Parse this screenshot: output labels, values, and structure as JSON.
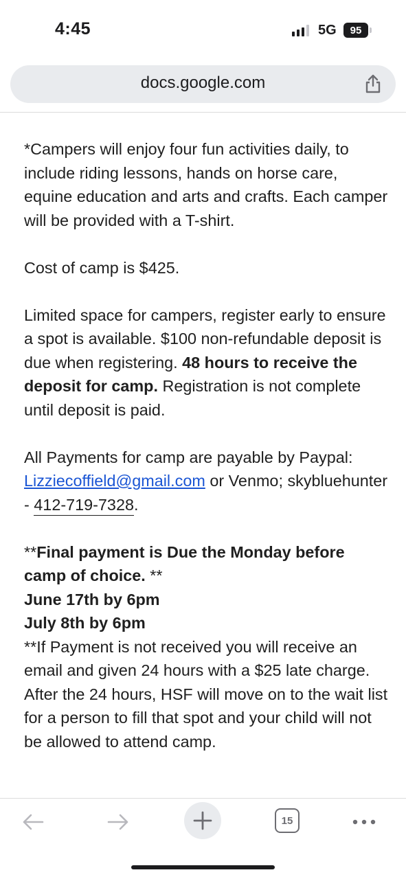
{
  "status_bar": {
    "time": "4:45",
    "network": "5G",
    "battery": "95"
  },
  "browser": {
    "url": "docs.google.com",
    "tab_count": "15"
  },
  "document": {
    "activities": "*Campers will enjoy four fun activities daily, to include riding lessons, hands on horse care, equine education and arts and crafts. Each camper will be provided with a T-shirt.",
    "cost": "Cost of camp is $425.",
    "space_intro": "Limited space for campers, register early to ensure a spot is available. $100 non-refundable deposit is due when registering.",
    "space_bold": "48 hours to receive the deposit for camp.",
    "space_tail": "Registration is not complete until deposit is paid.",
    "payments_intro": "All Payments for camp are payable  by Paypal:",
    "payments_email": "Lizziecoffield@gmail.com",
    "payments_mid": "or Venmo; skybluehunter -",
    "payments_phone": "412-719-7328",
    "payments_end": ".",
    "final_payment_prefix": "**",
    "final_payment_bold": "Final payment is Due the Monday before camp of choice.",
    "final_payment_suffix": " **",
    "date_1": "June 17th by 6pm",
    "date_2": "July 8th by 6pm",
    "late_notice": "**If Payment is not received you will receive an email and given 24 hours with a $25 late charge. After the 24 hours, HSF will move on to the wait list for a person to fill that spot and your child will not be allowed to attend camp."
  },
  "colors": {
    "link": "#1a55d4",
    "url_bar_bg": "#e9ebee",
    "icon_gray": "#6d6d72"
  },
  "icons": [
    "share-icon",
    "back-arrow-icon",
    "forward-arrow-icon",
    "plus-icon",
    "tabs-icon",
    "more-dots-icon"
  ]
}
